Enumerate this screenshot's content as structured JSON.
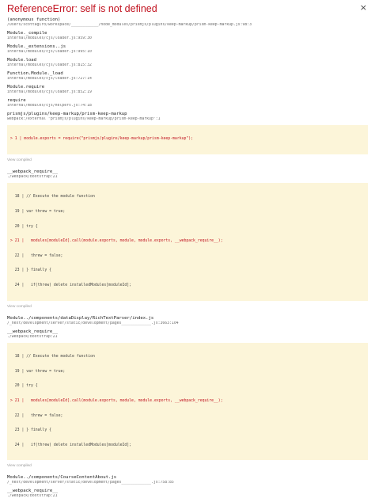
{
  "error_title": "ReferenceError: self is not defined",
  "close_label": "×",
  "view_compiled_label": "View compiled",
  "frames_top": [
    {
      "fn": "(anonymous function)",
      "file": "/Users/scottagiro/workspace/____________/node_modules/prismjs/plugins/keep-markup/prism-keep-markup.js:98:3"
    },
    {
      "fn": "Module._compile",
      "file": "internal/modules/cjs/loader.js:959:30"
    },
    {
      "fn": "Module._extensions..js",
      "file": "internal/modules/cjs/loader.js:995:10"
    },
    {
      "fn": "Module.load",
      "file": "internal/modules/cjs/loader.js:815:32"
    },
    {
      "fn": "Function.Module._load",
      "file": "internal/modules/cjs/loader.js:727:14"
    },
    {
      "fn": "Module.require",
      "file": "internal/modules/cjs/loader.js:852:19"
    },
    {
      "fn": "require",
      "file": "internal/modules/cjs/helpers.js:74:18"
    },
    {
      "fn": "prismjs/plugins/keep-markup/prism-keep-markup",
      "file": "webpack:/external \"prismjs/plugins/keep-markup/prism-keep-markup\":1"
    }
  ],
  "code1": [
    {
      "text": "> 1 | module.exports = require(\"prismjs/plugins/keep-markup/prism-keep-markup\");",
      "hl": true
    }
  ],
  "frame_req1": {
    "fn": "__webpack_require__",
    "file": "./webpack/bootstrap:21"
  },
  "code2": [
    {
      "text": "  18 | // Execute the module function",
      "hl": false
    },
    {
      "text": "  19 | var threw = true;",
      "hl": false
    },
    {
      "text": "  20 | try {",
      "hl": false
    },
    {
      "text": "> 21 |   modules[moduleId].call(module.exports, module, module.exports, __webpack_require__);",
      "hl": true
    },
    {
      "text": "  22 |   threw = false;",
      "hl": false
    },
    {
      "text": "  23 | } finally {",
      "hl": false
    },
    {
      "text": "  24 |   if(threw) delete installedModules[moduleId];",
      "hl": false
    }
  ],
  "frame_rtp": {
    "fn": "Module../components/dataDisplay/RichTextParser/index.js",
    "file": "/_next/development/server/static/development/pages_____________.js:3663:104"
  },
  "frame_req2": {
    "fn": "__webpack_require__",
    "file": "./webpack/bootstrap:21"
  },
  "code3": [
    {
      "text": "  18 | // Execute the module function",
      "hl": false
    },
    {
      "text": "  19 | var threw = true;",
      "hl": false
    },
    {
      "text": "  20 | try {",
      "hl": false
    },
    {
      "text": "> 21 |   modules[moduleId].call(module.exports, module, module.exports, __webpack_require__);",
      "hl": true
    },
    {
      "text": "  22 |   threw = false;",
      "hl": false
    },
    {
      "text": "  23 | } finally {",
      "hl": false
    },
    {
      "text": "  24 |   if(threw) delete installedModules[moduleId];",
      "hl": false
    }
  ],
  "frame_cca": {
    "fn": "Module../components/CourseContentAbout.js",
    "file": "/_next/development/server/static/development/pages_____________.js:758:85"
  },
  "frame_req3": {
    "fn": "__webpack_require__",
    "file": "./webpack/bootstrap:21"
  }
}
